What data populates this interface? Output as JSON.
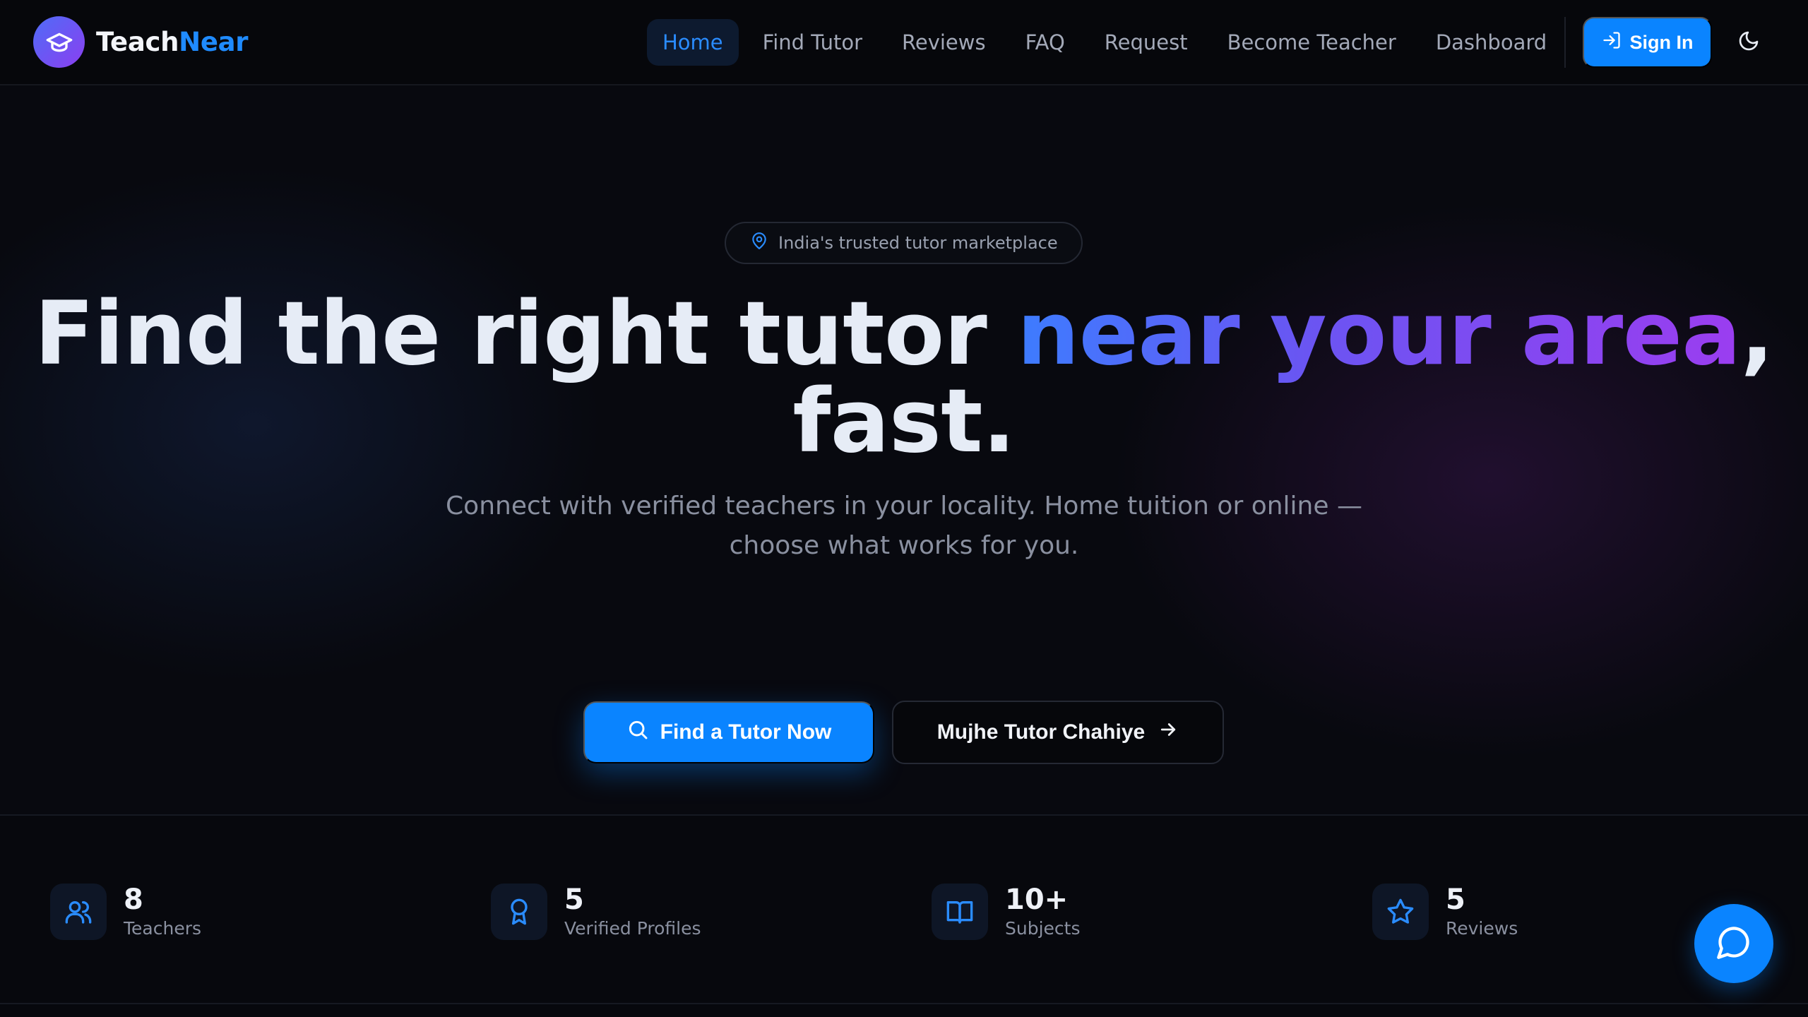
{
  "brand": {
    "name_part1": "Teach",
    "name_part2": "Near",
    "logo_icon": "graduation-cap-icon"
  },
  "nav": {
    "items": [
      {
        "label": "Home",
        "active": true
      },
      {
        "label": "Find Tutor",
        "active": false
      },
      {
        "label": "Reviews",
        "active": false
      },
      {
        "label": "FAQ",
        "active": false
      },
      {
        "label": "Request",
        "active": false
      },
      {
        "label": "Become Teacher",
        "active": false
      },
      {
        "label": "Dashboard",
        "active": false
      }
    ],
    "signin_label": "Sign In",
    "theme_toggle_icon": "moon-icon"
  },
  "hero": {
    "badge": "India's trusted tutor marketplace",
    "headline_plain_1": "Find the right tutor ",
    "headline_highlight": "near your area",
    "headline_plain_2": ",",
    "headline_line2": "fast.",
    "subheadline": "Connect with verified teachers in your locality. Home tuition or online — choose what works for you.",
    "primary_cta": "Find a Tutor Now",
    "secondary_cta": "Mujhe Tutor Chahiye"
  },
  "stats": [
    {
      "value": "8",
      "label": "Teachers",
      "icon": "users-icon"
    },
    {
      "value": "5",
      "label": "Verified Profiles",
      "icon": "award-icon"
    },
    {
      "value": "10+",
      "label": "Subjects",
      "icon": "book-icon"
    },
    {
      "value": "5",
      "label": "Reviews",
      "icon": "star-icon"
    }
  ],
  "colors": {
    "accent": "#0a84ff",
    "gradient_start": "#3d7cff",
    "gradient_end": "#9b3df0",
    "background": "#07080d"
  }
}
